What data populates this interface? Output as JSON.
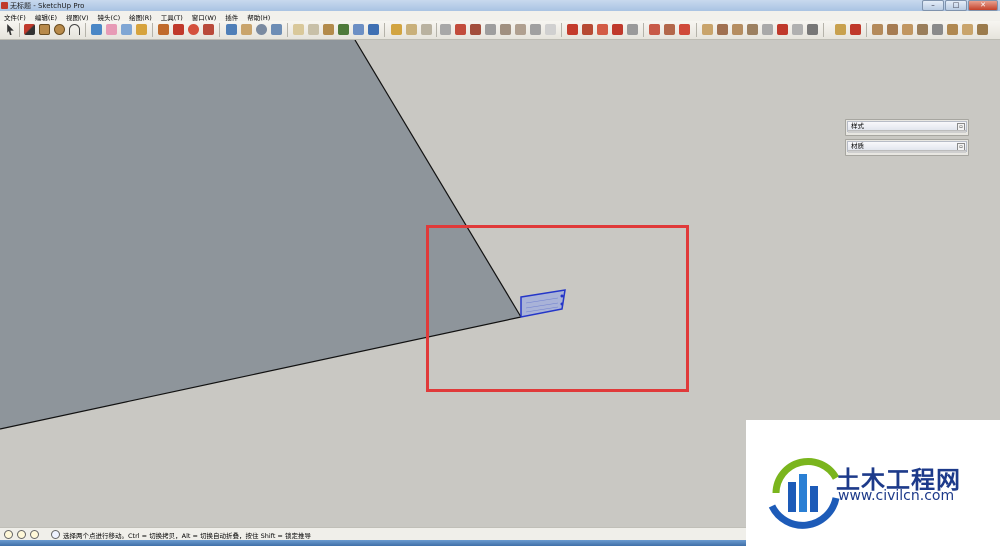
{
  "window": {
    "title": "无标题 - SketchUp Pro",
    "controls": {
      "minimize": "–",
      "maximize": "□",
      "close": "✕"
    }
  },
  "menu": [
    "文件(F)",
    "编辑(E)",
    "视图(V)",
    "镜头(C)",
    "绘图(R)",
    "工具(T)",
    "窗口(W)",
    "插件",
    "帮助(H)"
  ],
  "panels": [
    {
      "label": "样式",
      "button": "▫"
    },
    {
      "label": "材质",
      "button": "▫"
    }
  ],
  "status": {
    "message": "选择两个点进行移动。Ctrl = 切换拷贝，Alt = 切换自动折叠，按住 Shift = 锁定推导"
  },
  "watermark": {
    "name": "土木工程网",
    "url": "www.civilcn.com"
  },
  "colors": {
    "surface_face": "#8e959b",
    "background": "#c9c8c3",
    "selection_box": "#e03a3a",
    "move_cursor": "#2436c8"
  }
}
